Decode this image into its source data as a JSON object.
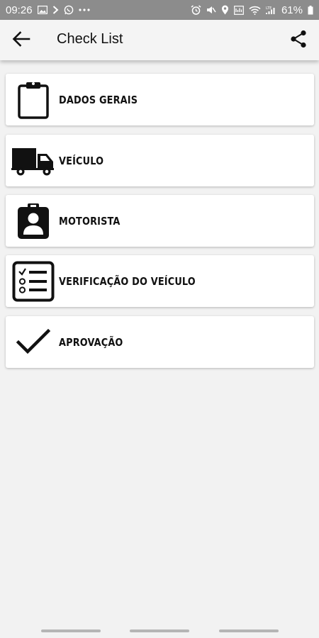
{
  "status_bar": {
    "time": "09:26",
    "left_icons": [
      "image-icon",
      "chevron-right-icon",
      "whatsapp-icon",
      "more-dots-icon"
    ],
    "right_icons": [
      "alarm-icon",
      "mute-icon",
      "location-icon",
      "data-saver-icon",
      "wifi-icon",
      "signal-icon",
      "battery-icon"
    ],
    "battery": "61%"
  },
  "app_bar": {
    "title": "Check List",
    "back_icon": "arrow-back-icon",
    "share_icon": "share-icon"
  },
  "menu": {
    "items": [
      {
        "label": "DADOS GERAIS",
        "icon": "clipboard-icon"
      },
      {
        "label": "VEÍCULO",
        "icon": "truck-icon"
      },
      {
        "label": "MOTORISTA",
        "icon": "driver-badge-icon"
      },
      {
        "label": "VERIFICAÇÃO DO VEÍCULO",
        "icon": "checklist-icon"
      },
      {
        "label": "APROVAÇÃO",
        "icon": "checkmark-icon"
      }
    ]
  },
  "colors": {
    "status_bar": "#8c8c8c",
    "app_bar": "#f4f4f4",
    "background": "#f2f2f2",
    "card": "#ffffff",
    "icon": "#111111"
  }
}
